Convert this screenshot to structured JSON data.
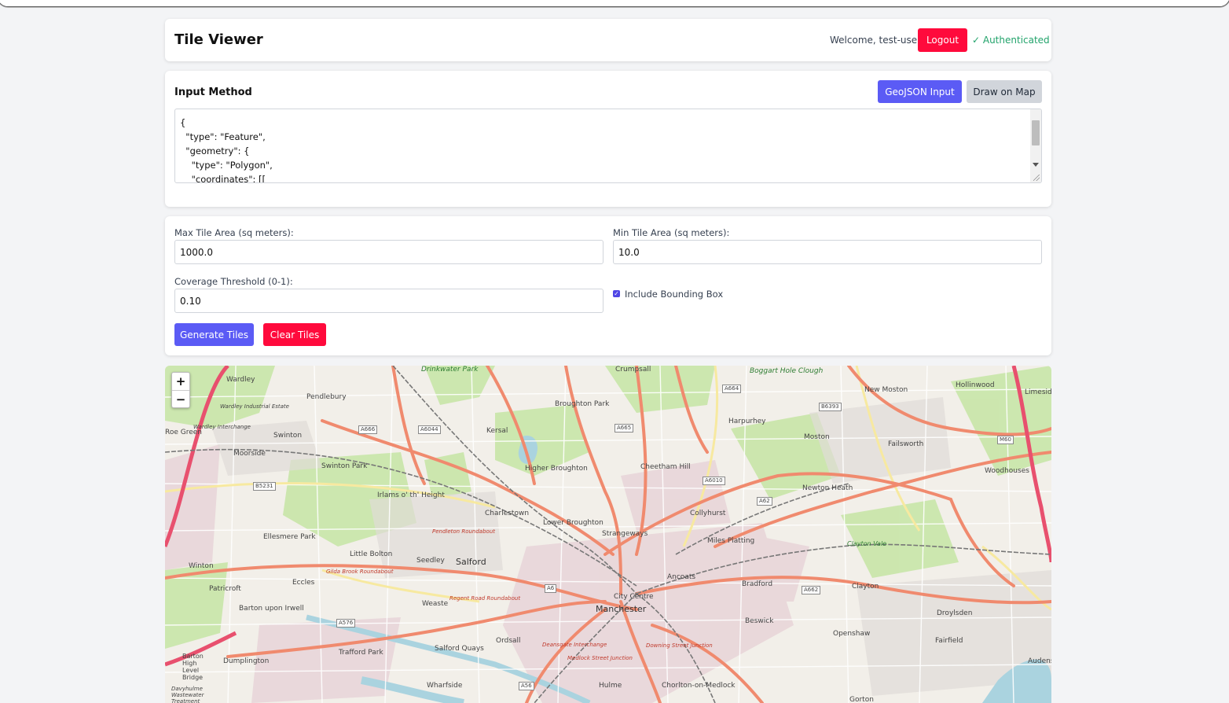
{
  "header": {
    "title": "Tile Viewer",
    "welcome": "Welcome, test-user",
    "logout_label": "Logout",
    "auth_status": "✓ Authenticated"
  },
  "input_method": {
    "title": "Input Method",
    "geojson_label": "GeoJSON Input",
    "draw_label": "Draw on Map",
    "geojson_text": "{\n  \"type\": \"Feature\",\n  \"geometry\": {\n    \"type\": \"Polygon\",\n    \"coordinates\": [["
  },
  "params": {
    "max_area_label": "Max Tile Area (sq meters):",
    "max_area_value": "1000.0",
    "min_area_label": "Min Tile Area (sq meters):",
    "min_area_value": "10.0",
    "coverage_label": "Coverage Threshold (0-1):",
    "coverage_value": "0.10",
    "bbox_label": "Include Bounding Box",
    "bbox_checked": true,
    "generate_label": "Generate Tiles",
    "clear_label": "Clear Tiles"
  },
  "map": {
    "zoom_in": "+",
    "zoom_out": "−",
    "places": [
      "Crumpsall",
      "Drinkwater Park",
      "Boggart Hole Clough",
      "Wardley",
      "Pendlebury",
      "Broughton Park",
      "New Moston",
      "Hollinwood",
      "Limeside",
      "Wardley Industrial Estate",
      "Wardley Interchange",
      "Harpurhey",
      "Swinton",
      "Kersal",
      "Moston",
      "Failsworth",
      "Moorside",
      "Swinton Park",
      "Higher Broughton",
      "Cheetham Hill",
      "Woodhouses",
      "Irlams o' th' Height",
      "Newton Heath",
      "Charlestown",
      "Lower Broughton",
      "Collyhurst",
      "Strangeways",
      "Ellesmere Park",
      "Miles Platting",
      "Clayton Vale",
      "Little Bolton",
      "Seedley",
      "Salford",
      "Winton",
      "Ancoats",
      "Bradford",
      "Clayton",
      "Eccles",
      "Patricroft",
      "City Centre",
      "Manchester",
      "Weaste",
      "Barton upon Irwell",
      "Droylsden",
      "Beswick",
      "Openshaw",
      "Ordsall",
      "Salford Quays",
      "Trafford Park",
      "Fairfield",
      "Dumplington",
      "Audenshaw",
      "Hulme",
      "Wharfside",
      "Chorlton-on-Medlock",
      "Gorton",
      "Barton High Level Bridge",
      "Davyhulme Wastewater Treatment",
      "Roe Green"
    ],
    "road_labels": [
      "A666",
      "A6044",
      "A665",
      "A664",
      "B6393",
      "A6010",
      "A62",
      "M60",
      "B5231",
      "A6",
      "A576",
      "A662",
      "A56"
    ],
    "junctions": [
      "Pendleton Roundabout",
      "Gilda Brook Roundabout",
      "Regent Road Roundabout",
      "Deansgate Interchange",
      "Downing Street Junction",
      "Medlock Street Junction"
    ]
  }
}
